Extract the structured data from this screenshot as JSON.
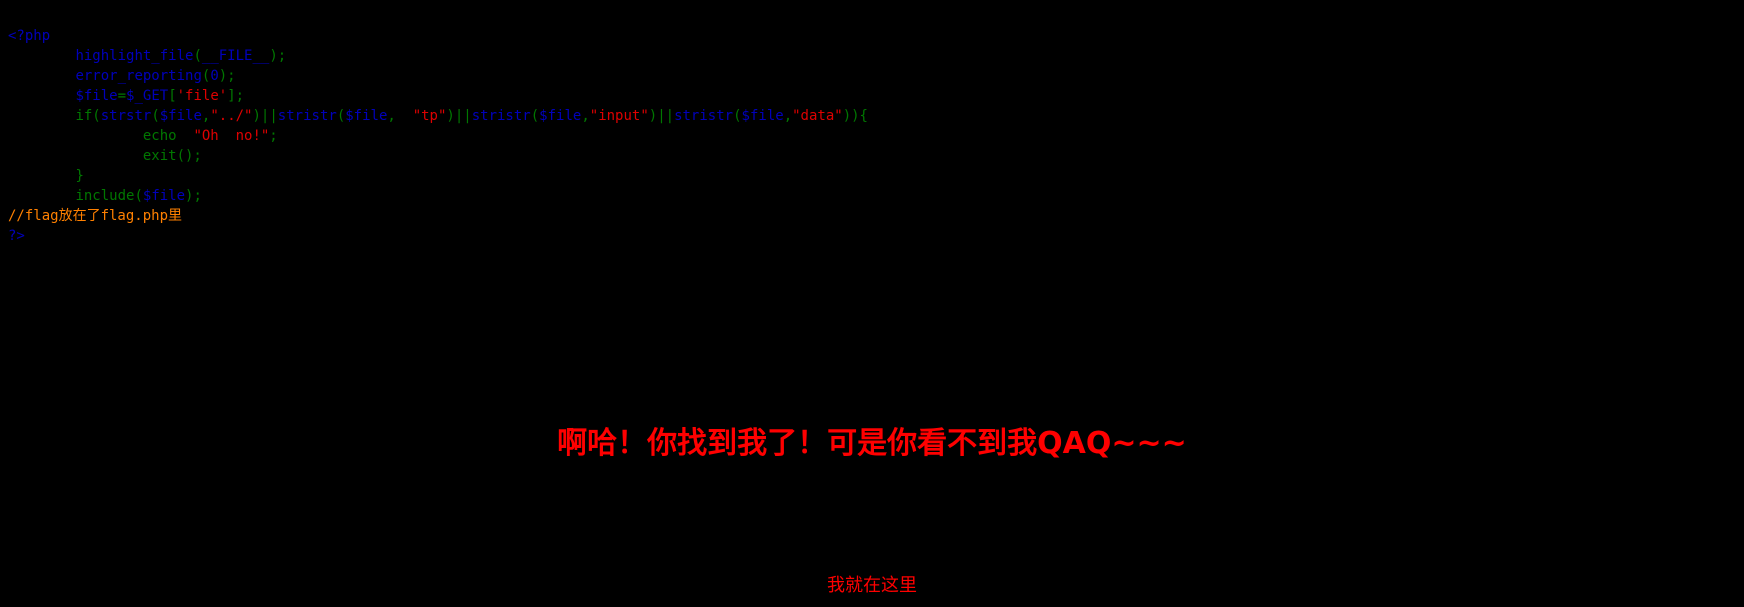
{
  "colors": {
    "background": "#000000",
    "keyword": "#0000BB",
    "function": "#007700",
    "string": "#DD0000",
    "comment": "#FF8000",
    "headline": "#FF0000"
  },
  "code": {
    "line1": "<?php",
    "line2": {
      "indent": "        ",
      "fn": "highlight_file",
      "open": "(",
      "arg": "__FILE__",
      "close": ");"
    },
    "line3": {
      "indent": "        ",
      "fn": "error_reporting",
      "open": "(",
      "arg": "0",
      "close": ");"
    },
    "line4": {
      "indent": "        ",
      "var": "$file",
      "eq": "=",
      "get": "$_GET",
      "open": "[",
      "key": "'file'",
      "close": "];"
    },
    "line5": {
      "indent": "        ",
      "if": "if(",
      "f1": "strstr",
      "p1": "(",
      "v1": "$file",
      "c1": ",",
      "s1": "\"../\"",
      "x1": ")||",
      "f2": "stristr",
      "p2": "(",
      "v2": "$file",
      "c2": ",  ",
      "s2": "\"tp\"",
      "x2": ")||",
      "f3": "stristr",
      "p3": "(",
      "v3": "$file",
      "c3": ",",
      "s3": "\"input\"",
      "x3": ")||",
      "f4": "stristr",
      "p4": "(",
      "v4": "$file",
      "c4": ",",
      "s4": "\"data\"",
      "x4": ")){"
    },
    "line6": {
      "indent": "                ",
      "echo": "echo  ",
      "str": "\"Oh  no!\"",
      "end": ";"
    },
    "line7": {
      "indent": "                ",
      "fn": "exit",
      "rest": "();"
    },
    "line8": {
      "indent": "        ",
      "brace": "}"
    },
    "line9": {
      "indent": "        ",
      "fn": "include",
      "open": "(",
      "var": "$file",
      "close": ");"
    },
    "line10": "//flag放在了flag.php里",
    "line11": "?>"
  },
  "headline": "啊哈！你找到我了！可是你看不到我QAQ~~~",
  "link_text": "我就在这里"
}
